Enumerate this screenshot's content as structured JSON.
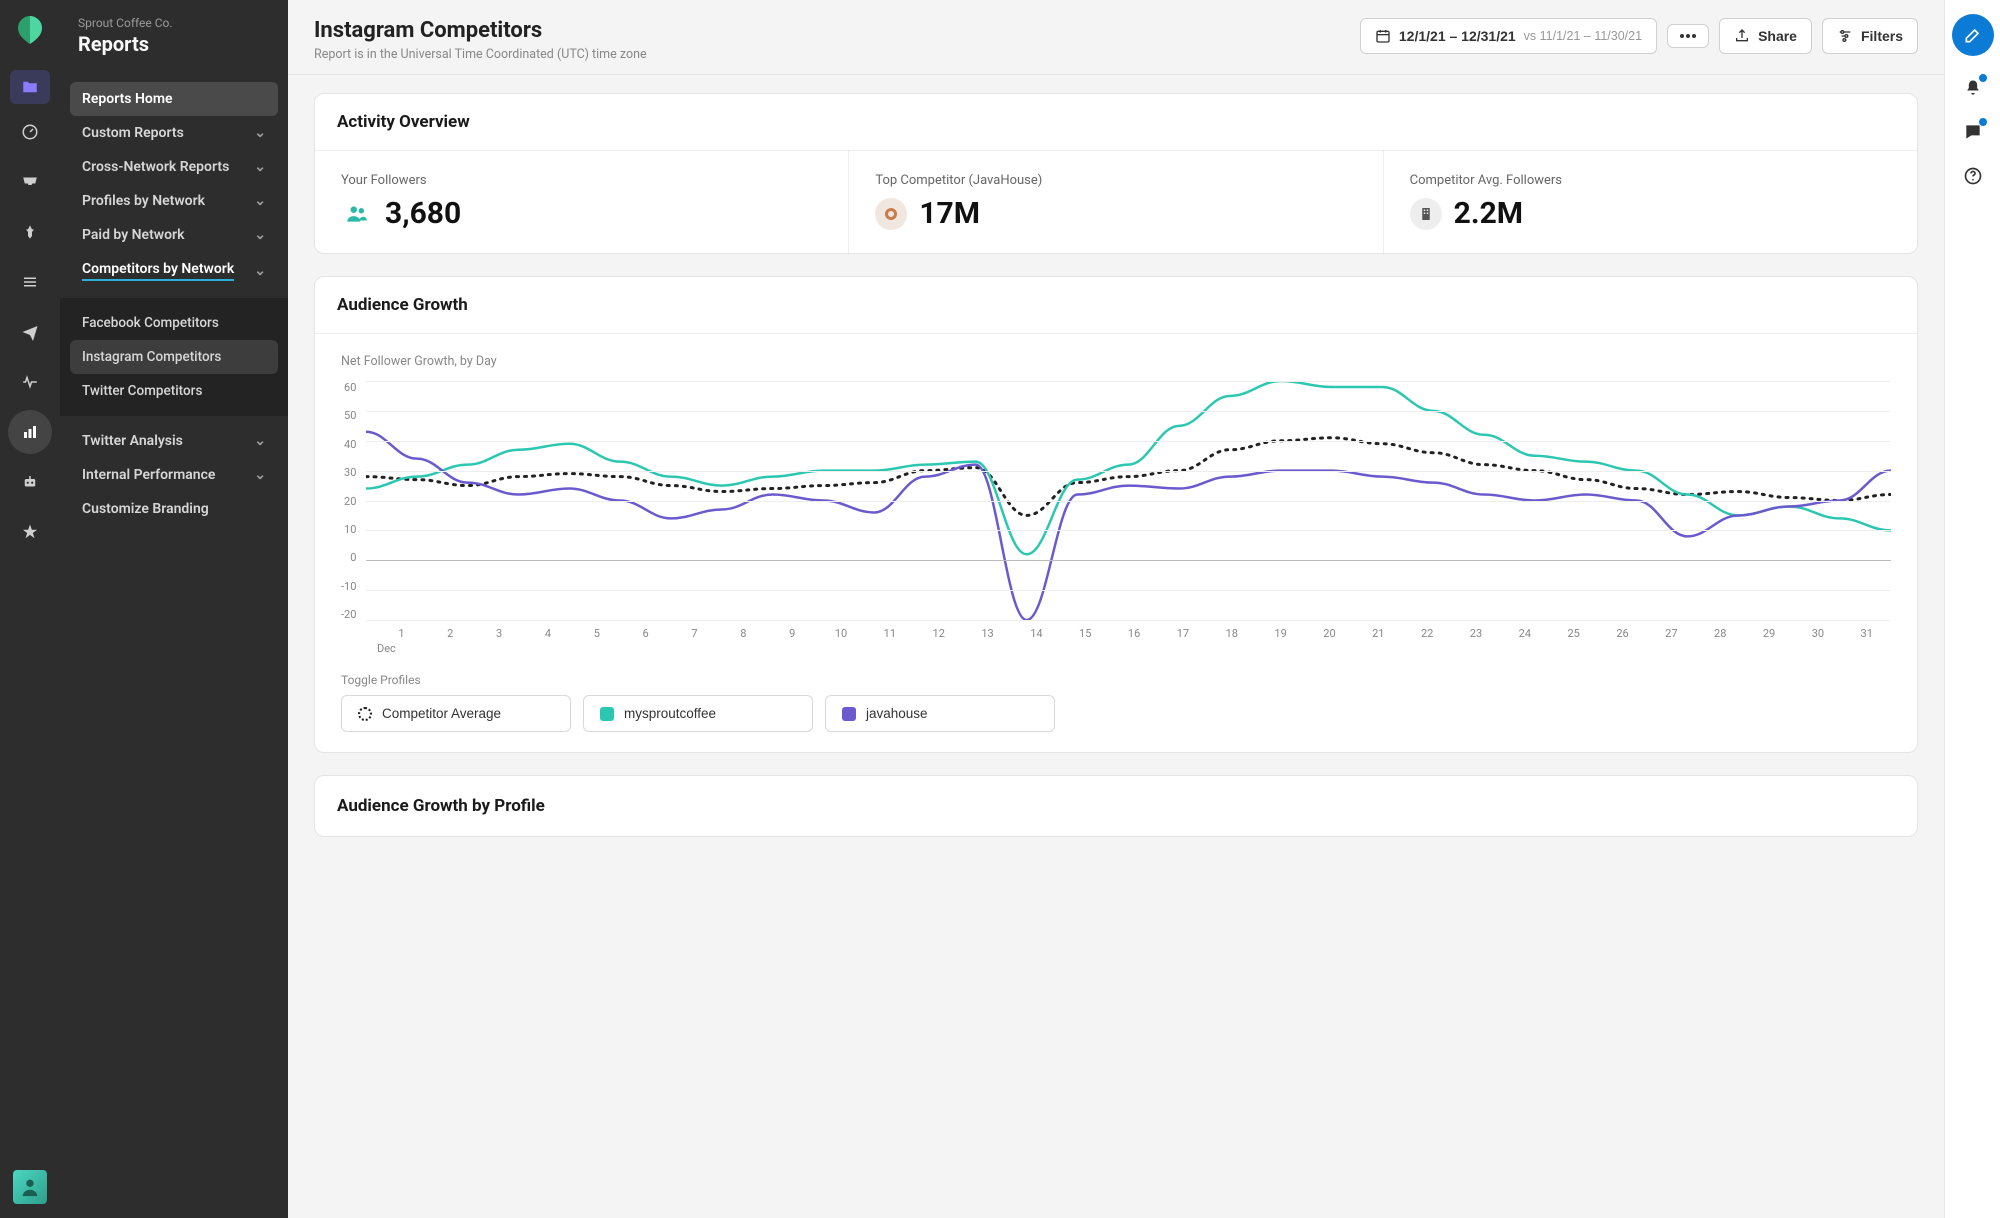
{
  "company": "Sprout Coffee Co.",
  "section_title": "Reports",
  "sidebar": {
    "home": "Reports Home",
    "items": [
      {
        "label": "Custom Reports"
      },
      {
        "label": "Cross-Network Reports"
      },
      {
        "label": "Profiles by Network"
      },
      {
        "label": "Paid by Network"
      },
      {
        "label": "Competitors by Network"
      }
    ],
    "sub": [
      {
        "label": "Facebook Competitors"
      },
      {
        "label": "Instagram Competitors"
      },
      {
        "label": "Twitter Competitors"
      }
    ],
    "tail": [
      {
        "label": "Twitter Analysis"
      },
      {
        "label": "Internal Performance"
      },
      {
        "label": "Customize Branding"
      }
    ]
  },
  "header": {
    "title": "Instagram Competitors",
    "subtitle": "Report is in the Universal Time Coordinated (UTC) time zone",
    "date_range": "12/1/21 – 12/31/21",
    "compare_range": "vs 11/1/21 – 11/30/21",
    "share": "Share",
    "filters": "Filters"
  },
  "overview": {
    "title": "Activity Overview",
    "stats": [
      {
        "label": "Your Followers",
        "value": "3,680",
        "color": "#2bb8a6"
      },
      {
        "label": "Top Competitor (JavaHouse)",
        "value": "17M",
        "color": "#c97b4a"
      },
      {
        "label": "Competitor Avg. Followers",
        "value": "2.2M",
        "color": "#666"
      }
    ]
  },
  "growth": {
    "title": "Audience Growth",
    "subtitle": "Net Follower Growth, by Day",
    "toggle_label": "Toggle Profiles",
    "x_month": "Dec",
    "toggles": [
      {
        "label": "Competitor Average",
        "color": "#222",
        "dashed": true
      },
      {
        "label": "mysproutcoffee",
        "color": "#2bc7b0"
      },
      {
        "label": "javahouse",
        "color": "#6a5acd"
      }
    ]
  },
  "growth_profile": {
    "title": "Audience Growth by Profile"
  },
  "chart_data": {
    "type": "line",
    "title": "Net Follower Growth, by Day",
    "xlabel": "Dec",
    "ylabel": "",
    "ylim": [
      -20,
      60
    ],
    "y_ticks": [
      60,
      50,
      40,
      30,
      20,
      10,
      0,
      -10,
      -20
    ],
    "x": [
      1,
      2,
      3,
      4,
      5,
      6,
      7,
      8,
      9,
      10,
      11,
      12,
      13,
      14,
      15,
      16,
      17,
      18,
      19,
      20,
      21,
      22,
      23,
      24,
      25,
      26,
      27,
      28,
      29,
      30,
      31
    ],
    "series": [
      {
        "name": "Competitor Average",
        "color": "#222",
        "style": "dotted",
        "values": [
          28,
          27,
          25,
          28,
          29,
          28,
          25,
          23,
          24,
          25,
          26,
          30,
          31,
          15,
          26,
          28,
          30,
          37,
          40,
          41,
          39,
          36,
          32,
          30,
          27,
          24,
          22,
          23,
          21,
          20,
          22
        ]
      },
      {
        "name": "mysproutcoffee",
        "color": "#2bc7b0",
        "style": "solid",
        "values": [
          24,
          28,
          32,
          37,
          39,
          33,
          28,
          25,
          28,
          30,
          30,
          32,
          33,
          2,
          27,
          32,
          45,
          55,
          60,
          58,
          58,
          50,
          42,
          35,
          33,
          30,
          22,
          15,
          18,
          14,
          10
        ]
      },
      {
        "name": "javahouse",
        "color": "#6a5acd",
        "style": "solid",
        "values": [
          43,
          34,
          26,
          22,
          24,
          20,
          14,
          17,
          22,
          20,
          16,
          28,
          32,
          -20,
          22,
          25,
          24,
          28,
          30,
          30,
          28,
          26,
          22,
          20,
          22,
          20,
          8,
          15,
          18,
          20,
          30
        ]
      }
    ]
  }
}
